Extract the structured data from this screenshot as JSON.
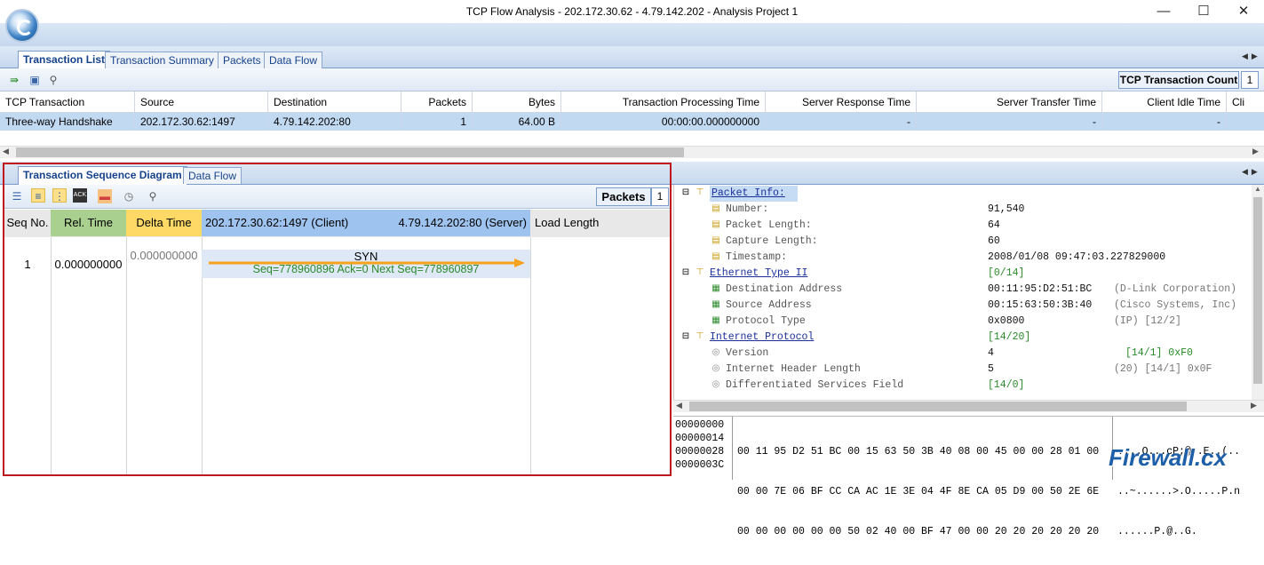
{
  "window": {
    "title": "TCP Flow Analysis - 202.172.30.62 - 4.79.142.202 - Analysis Project 1",
    "minimize": "—",
    "maximize": "☐",
    "close": "✕"
  },
  "top_tabs": [
    "Transaction List",
    "Transaction Summary",
    "Packets",
    "Data Flow"
  ],
  "top_toolbar": {
    "count_label": "TCP Transaction Count",
    "count_value": "1"
  },
  "transactions": {
    "columns": [
      "TCP Transaction",
      "Source",
      "Destination",
      "Packets",
      "Bytes",
      "Transaction Processing Time",
      "Server Response Time",
      "Server Transfer Time",
      "Client Idle Time",
      "Cli"
    ],
    "rows": [
      [
        "Three-way Handshake",
        "202.172.30.62:1497",
        "4.79.142.202:80",
        "1",
        "64.00 B",
        "00:00:00.000000000",
        "-",
        "-",
        "-"
      ]
    ]
  },
  "bottom_tabs": [
    "Transaction Sequence Diagram",
    "Data Flow"
  ],
  "bottom_toolbar": {
    "packets_label": "Packets",
    "packets_value": "1"
  },
  "sequence": {
    "headers": {
      "seq": "Seq No.",
      "rel": "Rel. Time",
      "delta": "Delta Time",
      "client": "202.172.30.62:1497 (Client)",
      "server": "4.79.142.202:80 (Server)",
      "load": "Load Length"
    },
    "row": {
      "seq": "1",
      "rel": "0.000000000",
      "delta": "0.000000000",
      "flag": "SYN",
      "detail": "Seq=778960896  Ack=0  Next Seq=778960897"
    },
    "colors": {
      "rel": "#a9d08e",
      "delta": "#ffd966",
      "client": "#9ec3ee",
      "arrow": "#f6a21b"
    }
  },
  "packet_tree": [
    {
      "label": "Packet Info:",
      "value": "",
      "extra": "",
      "type": "section-highlight"
    },
    {
      "label": "Number:",
      "value": "91,540",
      "extra": ""
    },
    {
      "label": "Packet Length:",
      "value": "64",
      "extra": ""
    },
    {
      "label": "Capture Length:",
      "value": "60",
      "extra": ""
    },
    {
      "label": "Timestamp:",
      "value": "2008/01/08 09:47:03.227829000",
      "extra": ""
    },
    {
      "label": "Ethernet Type II",
      "value": "[0/14]",
      "extra": "",
      "type": "section"
    },
    {
      "label": "Destination Address",
      "value": "00:11:95:D2:51:BC",
      "extra": "(D-Link Corporation)"
    },
    {
      "label": "Source Address",
      "value": "00:15:63:50:3B:40",
      "extra": "(Cisco Systems, Inc)"
    },
    {
      "label": "Protocol Type",
      "value": "0x0800",
      "extra": "(IP)  [12/2]"
    },
    {
      "label": "Internet Protocol",
      "value": "[14/20]",
      "extra": "",
      "type": "section"
    },
    {
      "label": "Version",
      "value": "4",
      "extra": "[14/1]  0xF0"
    },
    {
      "label": "Internet Header Length",
      "value": "5",
      "extra": "(20)  [14/1]  0x0F"
    },
    {
      "label": "Differentiated Services Field",
      "value": "[14/0]",
      "extra": ""
    }
  ],
  "hex_dump": {
    "offsets": [
      "00000000",
      "00000014",
      "00000028",
      "0000003C"
    ],
    "bytes": [
      "00 11 95 D2 51 BC 00 15 63 50 3B 40 08 00 45 00 00 28 01 00",
      "00 00 7E 06 BF CC CA AC 1E 3E 04 4F 8E CA 05 D9 00 50 2E 6E",
      "00 00 00 00 00 00 50 02 40 00 BF 47 00 00 20 20 20 20 20 20",
      ""
    ],
    "ascii": [
      "....Q...cP;@..E..(..",
      "..~......>.O.....P.n",
      "......P.@..G.      ",
      ""
    ]
  },
  "watermark": "Firewall.cx"
}
